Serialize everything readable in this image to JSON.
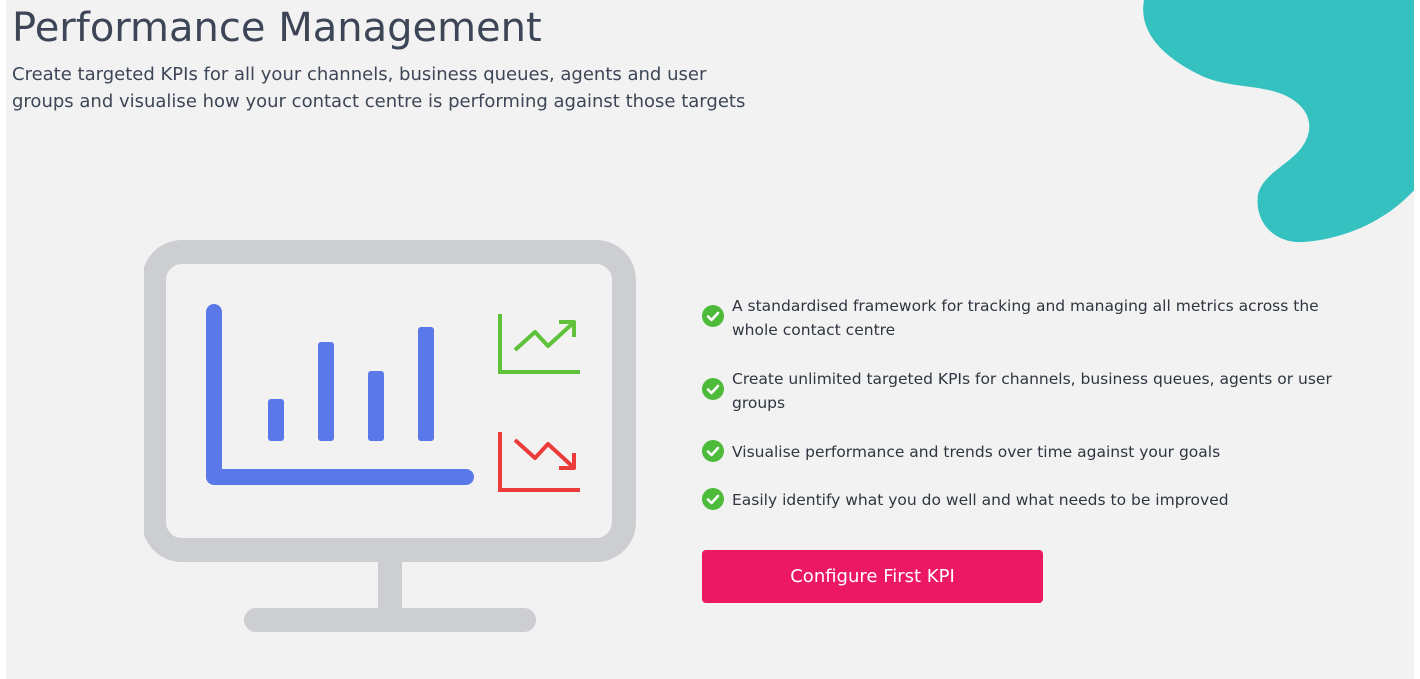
{
  "header": {
    "title": "Performance Management",
    "subtitle": "Create targeted KPIs for all your channels, business queues, agents and user groups and visualise how your contact centre is performing against those targets"
  },
  "features": [
    {
      "icon": "check-circle-icon",
      "text": "A standardised framework for tracking and managing all metrics across the whole contact centre"
    },
    {
      "icon": "check-circle-icon",
      "text": "Create unlimited targeted KPIs for channels, business queues, agents or user groups"
    },
    {
      "icon": "check-circle-icon",
      "text": "Visualise performance and trends over time against your goals"
    },
    {
      "icon": "check-circle-icon",
      "text": "Easily identify what you do well and what needs to be improved"
    }
  ],
  "cta": {
    "label": "Configure First KPI"
  },
  "illustration": {
    "icons": [
      "monitor-icon",
      "bar-chart-icon",
      "trend-up-icon",
      "trend-down-icon"
    ]
  },
  "colors": {
    "background": "#f2f2f2",
    "accent_teal": "#35c1bf",
    "cta": "#ec1864",
    "check_green": "#4cbb3a",
    "monitor_grey": "#ccced1",
    "bar_blue": "#5b78ea",
    "trend_up": "#5fc23a",
    "trend_down": "#ec3b3b",
    "title_text": "#3d4656"
  }
}
